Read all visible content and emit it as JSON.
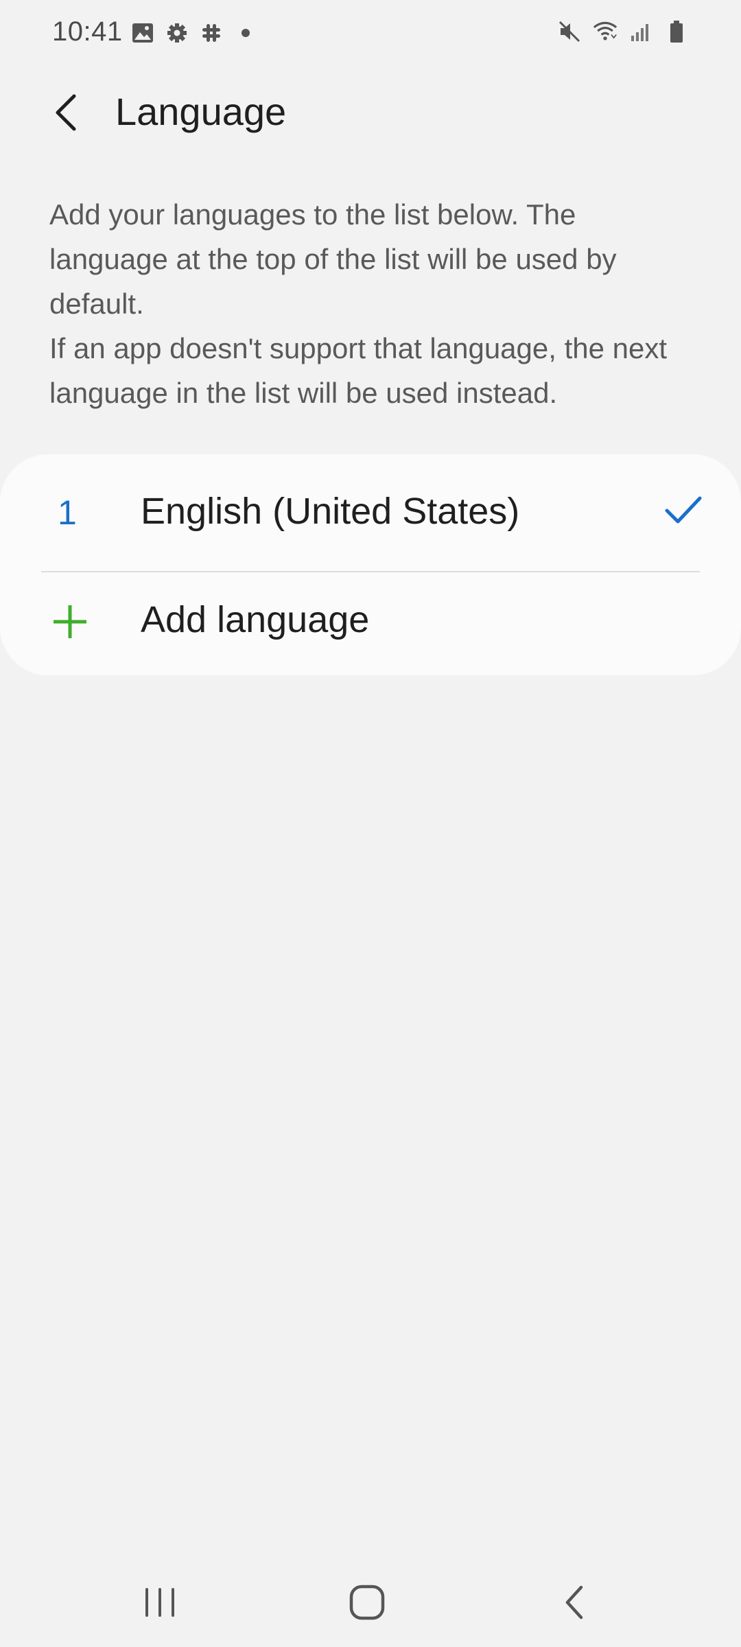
{
  "status_bar": {
    "time": "10:41",
    "left_icons": [
      "gallery-icon",
      "settings-icon",
      "slack-icon",
      "dot-icon"
    ],
    "right_icons": [
      "mute-icon",
      "wifi-icon",
      "signal-icon",
      "battery-icon"
    ]
  },
  "app_bar": {
    "title": "Language",
    "back_icon": "back-arrow-icon"
  },
  "description": {
    "line1": "Add your languages to the list below. The language at the top of the list will be used by default.",
    "line2": "If an app doesn't support that language, the next language in the list will be used instead."
  },
  "languages": [
    {
      "index": "1",
      "name": "English (United States)",
      "selected": true
    }
  ],
  "add_language": {
    "label": "Add language",
    "icon": "plus-icon"
  },
  "nav_bar": {
    "icons": [
      "recents-icon",
      "home-icon",
      "back-icon"
    ]
  },
  "colors": {
    "background": "#f2f2f2",
    "card": "#fbfbfb",
    "accent_blue": "#1a6fc9",
    "accent_green": "#3fae2a"
  }
}
